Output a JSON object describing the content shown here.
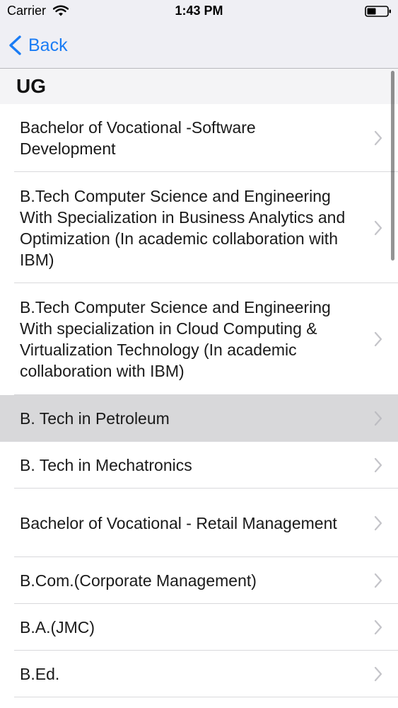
{
  "status_bar": {
    "carrier": "Carrier",
    "time": "1:43 PM"
  },
  "nav": {
    "back_label": "Back",
    "accent_color": "#1a7cf5"
  },
  "section": {
    "title": "UG"
  },
  "rows": [
    {
      "label": "Bachelor of Vocational -Software Development",
      "selected": false
    },
    {
      "label": "B.Tech Computer Science and Engineering With Specialization in Business Analytics and Optimization (In academic collaboration with IBM)",
      "selected": false
    },
    {
      "label": "B.Tech Computer Science and Engineering With specialization in Cloud Computing & Virtualization Technology (In academic collaboration with IBM)",
      "selected": false
    },
    {
      "label": "B. Tech in Petroleum",
      "selected": true
    },
    {
      "label": "B. Tech in Mechatronics",
      "selected": false
    },
    {
      "label": "Bachelor of Vocational - Retail Management",
      "selected": false
    },
    {
      "label": "B.Com.(Corporate Management)",
      "selected": false
    },
    {
      "label": "B.A.(JMC)",
      "selected": false
    },
    {
      "label": "B.Ed.",
      "selected": false
    }
  ]
}
